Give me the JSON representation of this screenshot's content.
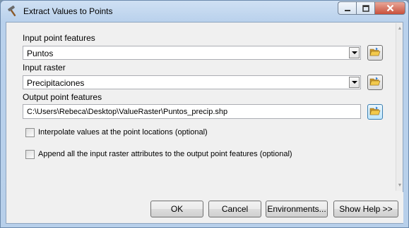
{
  "window": {
    "title": "Extract Values to Points",
    "icon": "hammer-icon",
    "controls": {
      "minimize": "minimize-icon",
      "maximize": "maximize-icon",
      "close": "close-icon"
    }
  },
  "form": {
    "input_point_features": {
      "label": "Input point features",
      "value": "Puntos"
    },
    "input_raster": {
      "label": "Input raster",
      "value": "Precipitaciones"
    },
    "output_point_features": {
      "label": "Output point features",
      "value": "C:\\Users\\Rebeca\\Desktop\\ValueRaster\\Puntos_precip.shp"
    },
    "interpolate": {
      "label": "Interpolate values at the point locations (optional)",
      "checked": false
    },
    "append_attributes": {
      "label": "Append all the input raster attributes to the output point features (optional)",
      "checked": false
    }
  },
  "buttons": {
    "ok": "OK",
    "cancel": "Cancel",
    "environments": "Environments...",
    "show_help": "Show Help >>"
  },
  "colors": {
    "title_bar": "#b9d1ec",
    "close_button": "#c9513c",
    "folder_icon": "#e8b63a"
  }
}
